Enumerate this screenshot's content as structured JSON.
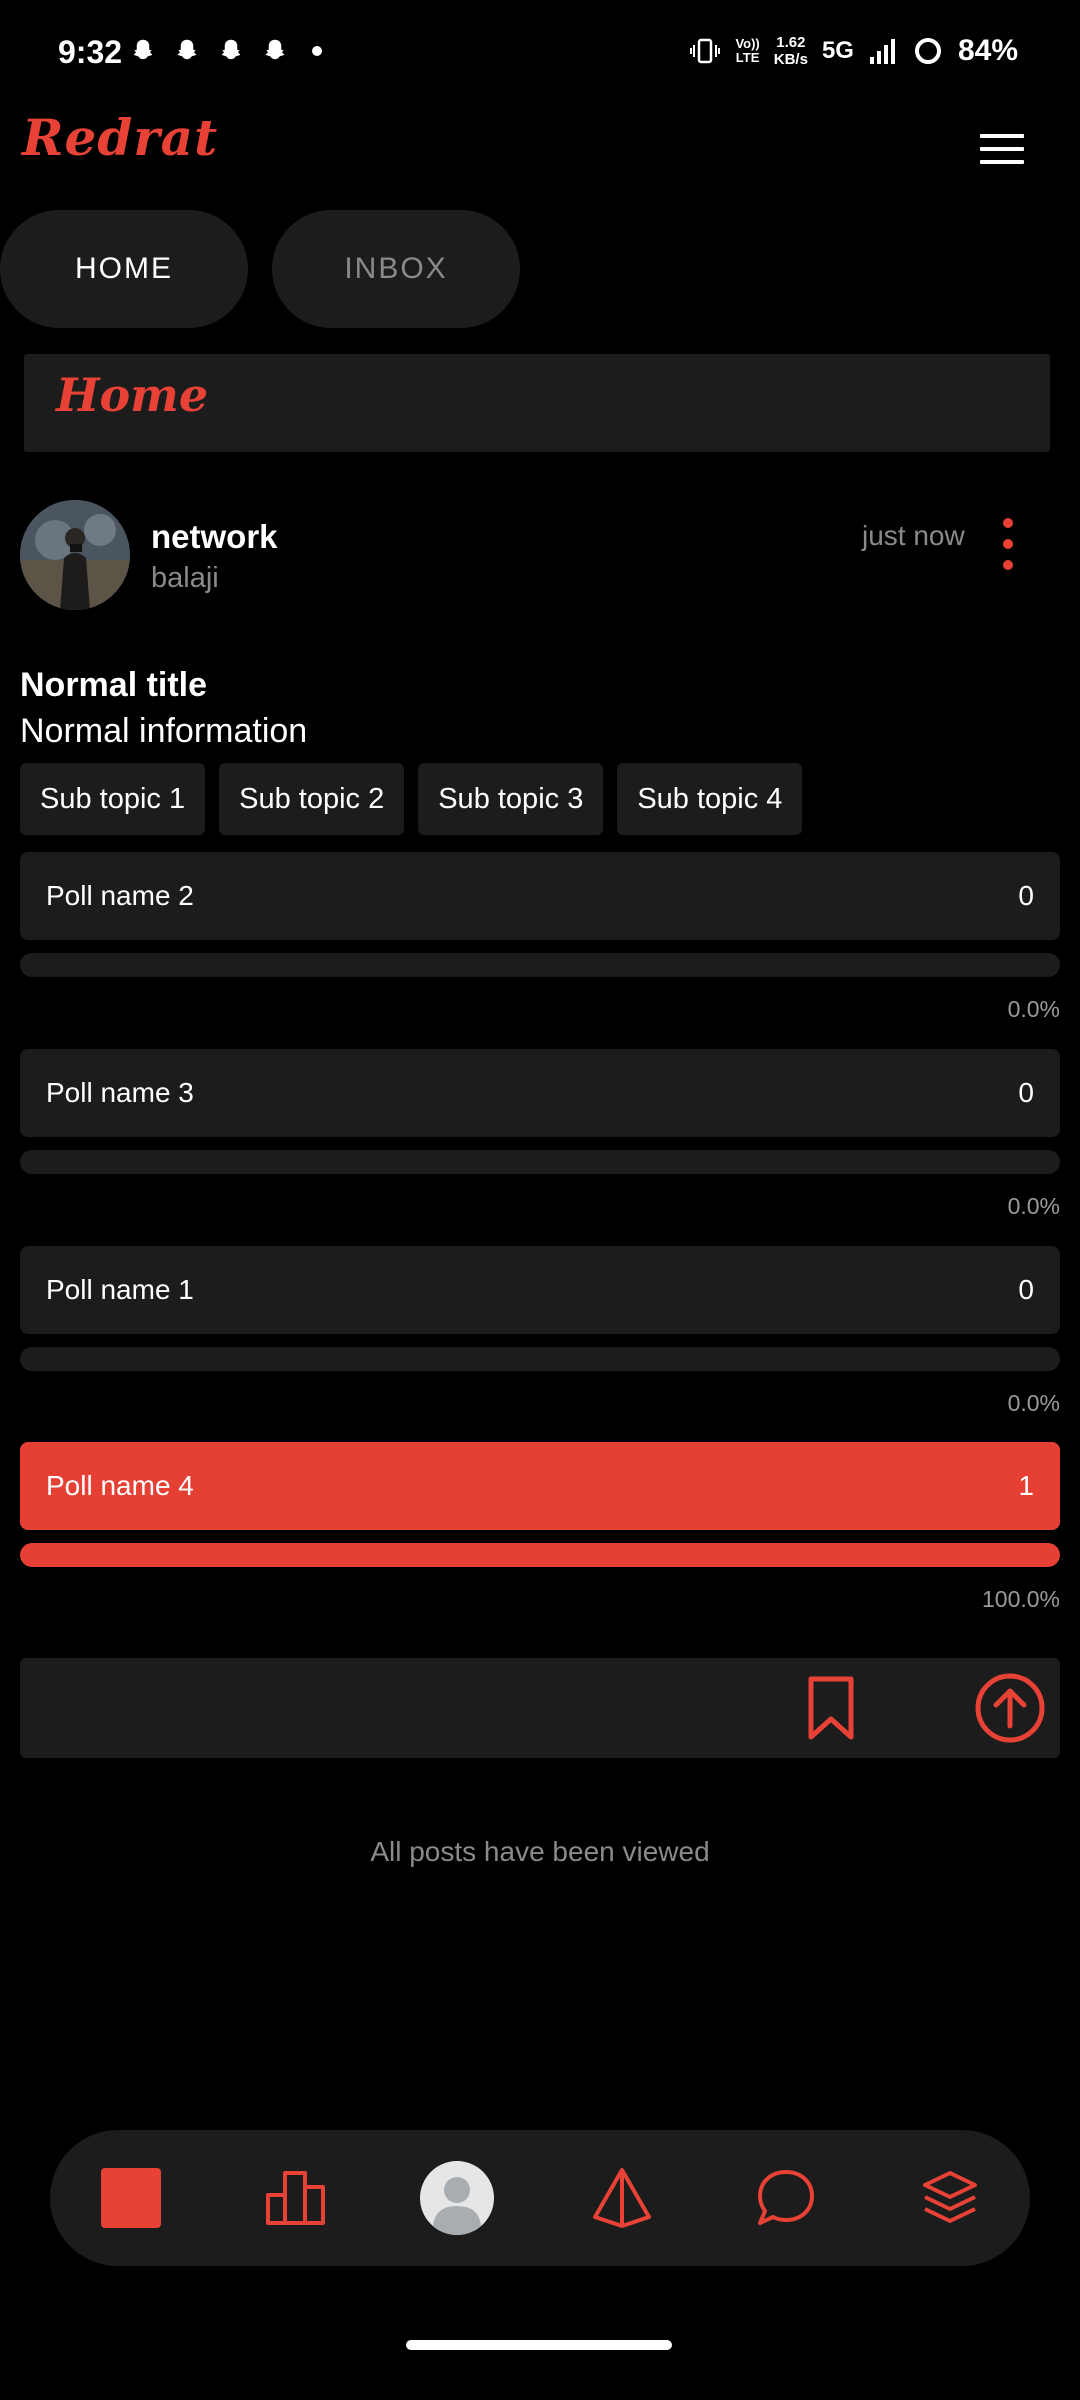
{
  "status_bar": {
    "time": "9:32",
    "volte": [
      "Vo))",
      "LTE"
    ],
    "speed": [
      "1.62",
      "KB/s"
    ],
    "network": "5G",
    "battery": "84%"
  },
  "header": {
    "brand": "Redrat",
    "menu_icon": "hamburger-icon"
  },
  "tabs": [
    {
      "label": "HOME",
      "active": true
    },
    {
      "label": "INBOX",
      "active": false
    }
  ],
  "section": {
    "title": "Home"
  },
  "post": {
    "author": "network",
    "handle": "balaji",
    "time": "just now",
    "title": "Normal title",
    "info": "Normal information",
    "topics": [
      "Sub topic 1",
      "Sub topic 2",
      "Sub topic 3",
      "Sub topic 4"
    ],
    "polls": [
      {
        "name": "Poll name 2",
        "votes": "0",
        "percent": "0.0%",
        "fraction": 0,
        "selected": false
      },
      {
        "name": "Poll name 3",
        "votes": "0",
        "percent": "0.0%",
        "fraction": 0,
        "selected": false
      },
      {
        "name": "Poll name 1",
        "votes": "0",
        "percent": "0.0%",
        "fraction": 0,
        "selected": false
      },
      {
        "name": "Poll name 4",
        "votes": "1",
        "percent": "100.0%",
        "fraction": 1,
        "selected": true
      }
    ]
  },
  "footer_message": "All posts have been viewed",
  "bottom_nav": [
    "home-square-icon",
    "leaderboard-icon",
    "profile-avatar",
    "explore-prism-icon",
    "chat-bubble-icon",
    "layers-icon"
  ],
  "colors": {
    "accent": "#e84236",
    "card": "#1c1c1c",
    "background": "#000000",
    "muted_text": "#8a8a8a"
  }
}
